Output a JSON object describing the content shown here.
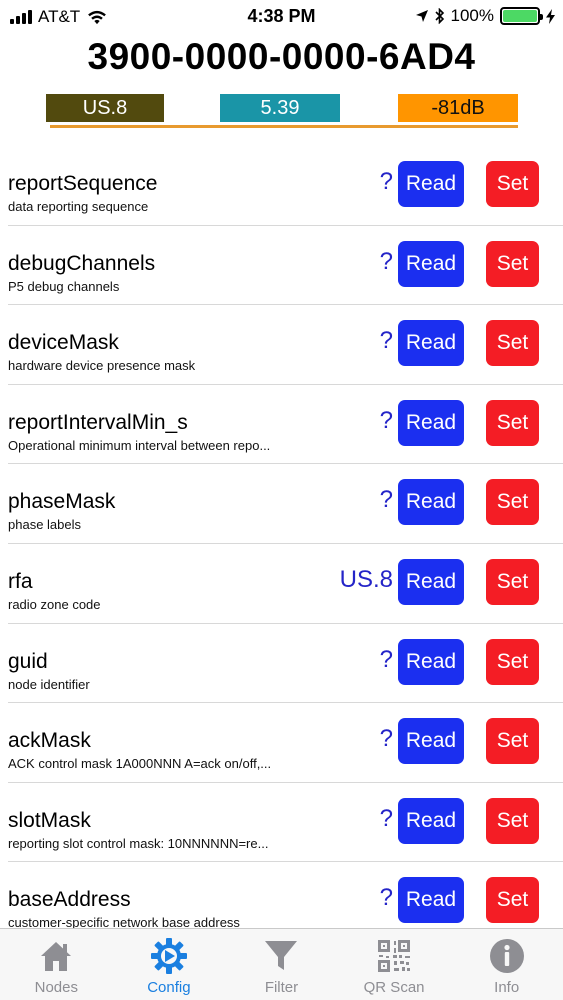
{
  "status_bar": {
    "carrier": "AT&T",
    "time": "4:38 PM",
    "battery_percent": "100%",
    "battery_level": 1.0
  },
  "header": {
    "device_id": "3900-0000-0000-6AD4",
    "region": "US.8",
    "version": "5.39",
    "rssi": "-81dB"
  },
  "colors": {
    "read_button": "#1b2ff0",
    "set_button": "#f41d25",
    "region_badge": "#524a0e",
    "version_badge": "#1a95a7",
    "rssi_badge": "#ff9500",
    "active_tab": "#1a7fe0"
  },
  "buttons": {
    "read_label": "Read",
    "set_label": "Set"
  },
  "rows": [
    {
      "name": "reportSequence",
      "desc": "data reporting sequence",
      "value": "?"
    },
    {
      "name": "debugChannels",
      "desc": "P5 debug channels",
      "value": "?"
    },
    {
      "name": "deviceMask",
      "desc": "hardware device presence mask",
      "value": "?"
    },
    {
      "name": "reportIntervalMin_s",
      "desc": "Operational minimum interval between repo...",
      "value": "?"
    },
    {
      "name": "phaseMask",
      "desc": "phase labels",
      "value": "?"
    },
    {
      "name": "rfa",
      "desc": "radio zone code",
      "value": "US.8"
    },
    {
      "name": "guid",
      "desc": "node identifier",
      "value": "?"
    },
    {
      "name": "ackMask",
      "desc": "ACK control mask 1A000NNN A=ack on/off,...",
      "value": "?"
    },
    {
      "name": "slotMask",
      "desc": "reporting slot control mask: 10NNNNNN=re...",
      "value": "?"
    },
    {
      "name": "baseAddress",
      "desc": "customer-specific network base address",
      "value": "?"
    }
  ],
  "tabs": [
    {
      "label": "Nodes",
      "icon": "house-icon",
      "active": false
    },
    {
      "label": "Config",
      "icon": "gear-icon",
      "active": true
    },
    {
      "label": "Filter",
      "icon": "funnel-icon",
      "active": false
    },
    {
      "label": "QR Scan",
      "icon": "qr-code-icon",
      "active": false
    },
    {
      "label": "Info",
      "icon": "info-icon",
      "active": false
    }
  ]
}
